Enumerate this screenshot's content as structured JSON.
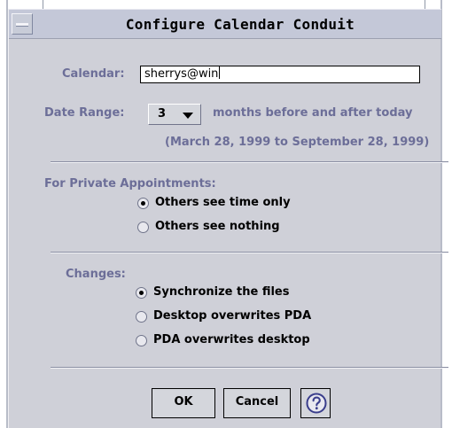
{
  "window": {
    "title": "Configure Calendar Conduit"
  },
  "calendar": {
    "label": "Calendar:",
    "value": "sherrys@win"
  },
  "date_range": {
    "label": "Date Range:",
    "selected": "3",
    "suffix": "months before and after today",
    "range_text": "(March 28, 1999 to September 28, 1999)"
  },
  "private_appointments": {
    "label": "For Private Appointments:",
    "options": [
      {
        "label": "Others see time only",
        "checked": true
      },
      {
        "label": "Others see nothing",
        "checked": false
      }
    ]
  },
  "changes": {
    "label": "Changes:",
    "options": [
      {
        "label": "Synchronize the files",
        "checked": true
      },
      {
        "label": "Desktop overwrites PDA",
        "checked": false
      },
      {
        "label": "PDA overwrites desktop",
        "checked": false
      }
    ]
  },
  "buttons": {
    "ok": "OK",
    "cancel": "Cancel",
    "help_icon": "help-question-icon"
  },
  "colors": {
    "label_color": "#6c6e98",
    "window_bg": "#cfd0d8",
    "titlebar_bg": "#c4c8d8"
  }
}
